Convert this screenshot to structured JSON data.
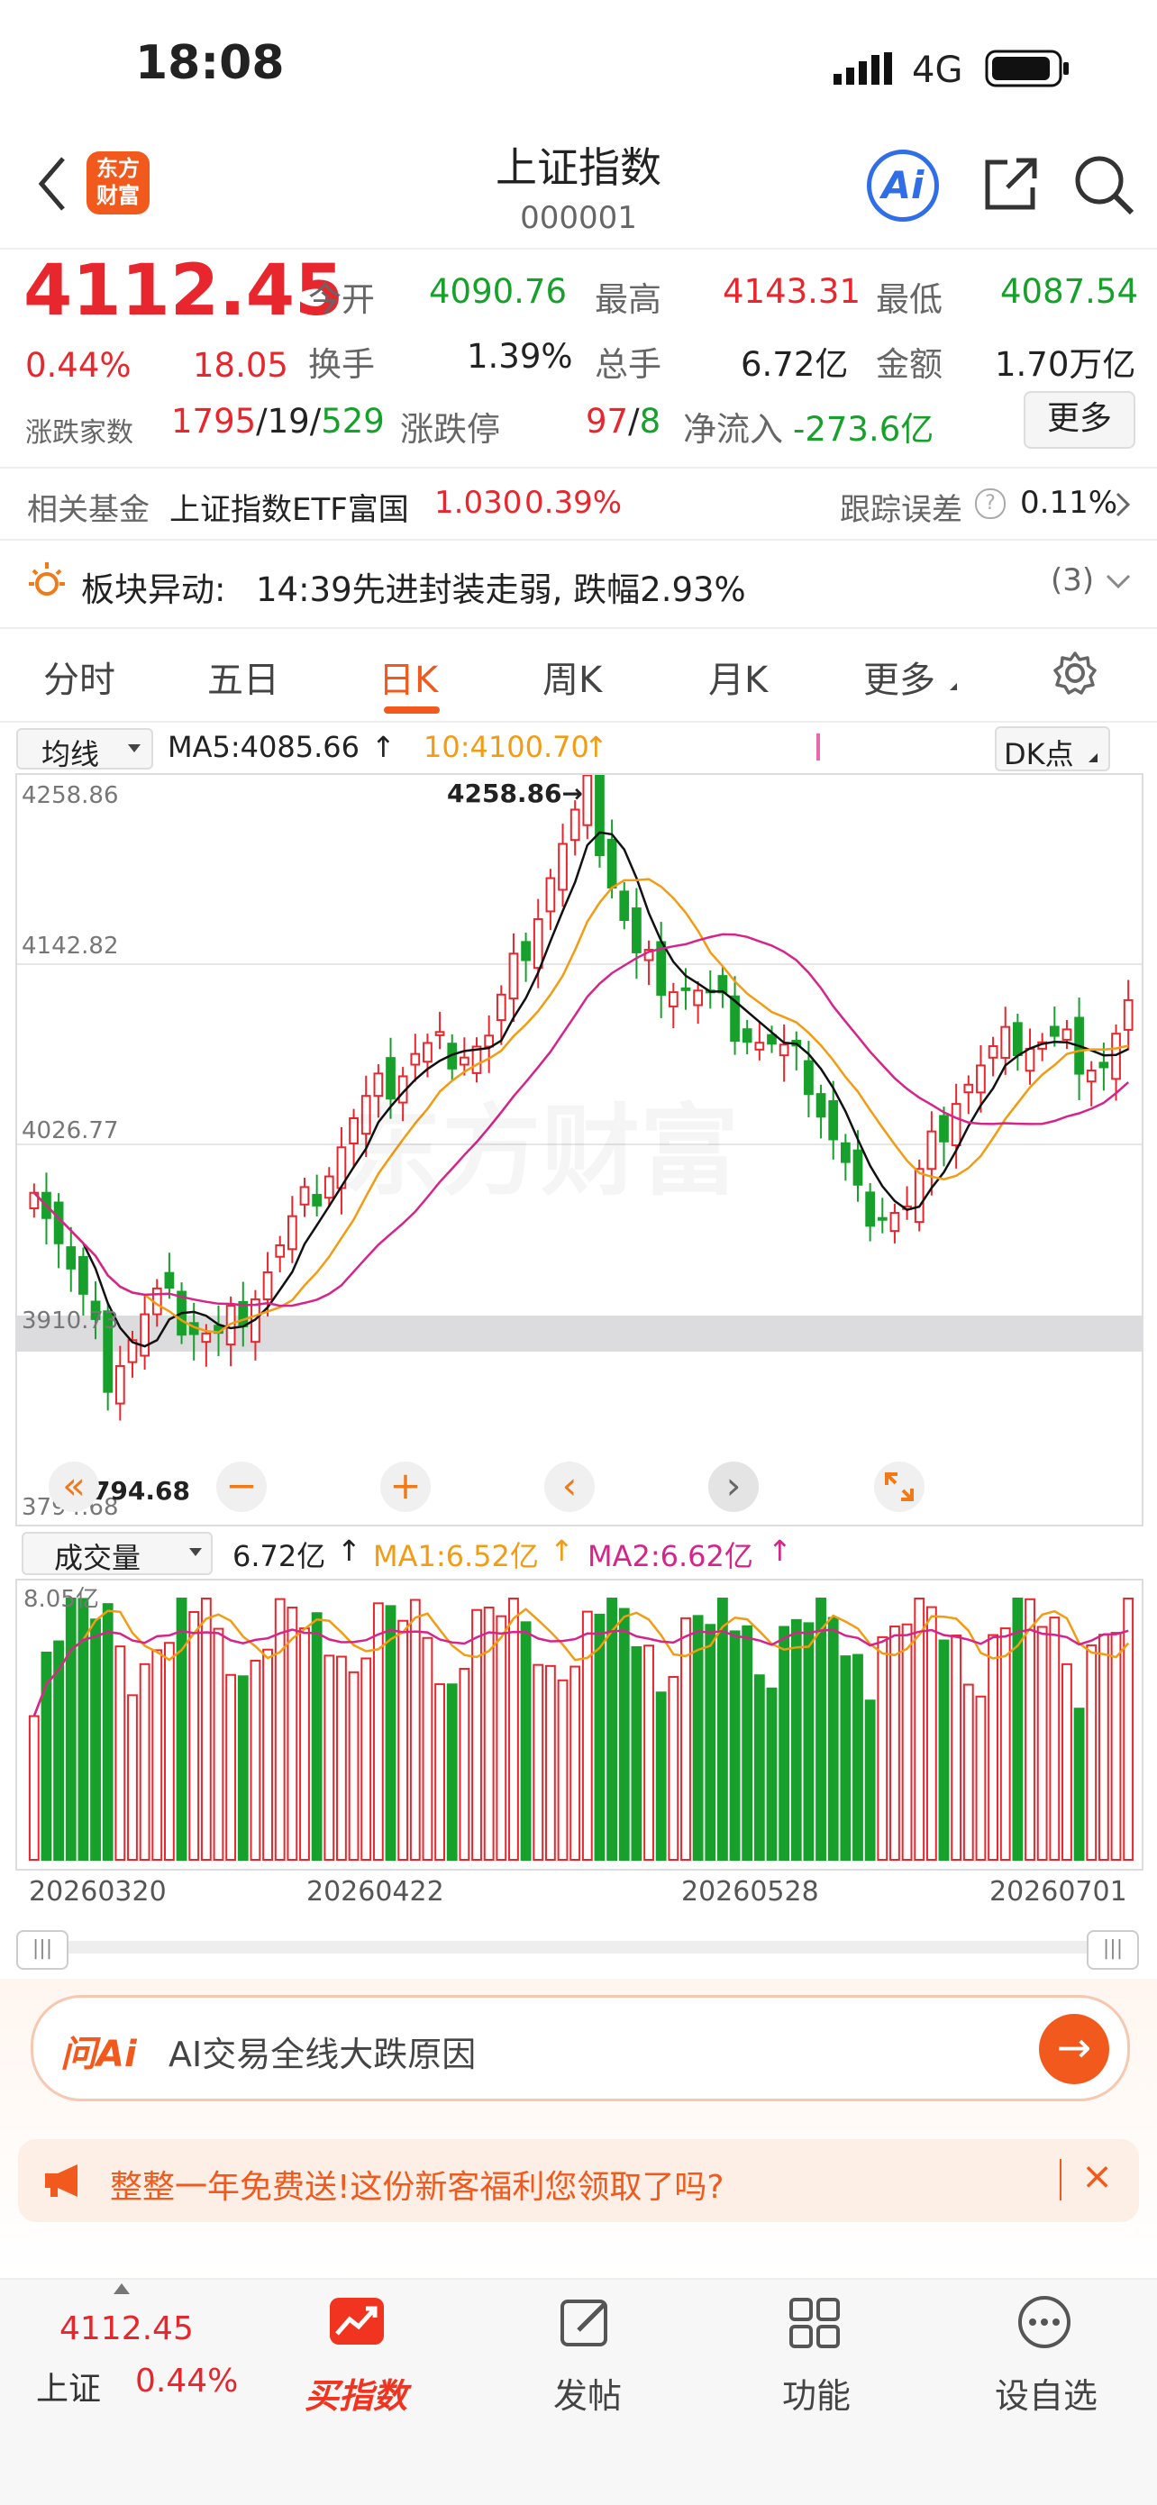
{
  "status_bar": {
    "time": "18:08",
    "network": "4G"
  },
  "header": {
    "title": "上证指数",
    "code": "000001",
    "logo_line1": "东方",
    "logo_line2": "财富",
    "ai_label": "Ai"
  },
  "quote": {
    "price": "4112.45",
    "change_pct": "0.44%",
    "change": "18.05",
    "open_label": "今开",
    "open": "4090.76",
    "high_label": "最高",
    "high": "4143.31",
    "low_label": "最低",
    "low": "4087.54",
    "turnover_label": "换手",
    "turnover": "1.39%",
    "volume_label": "总手",
    "volume": "6.72亿",
    "amount_label": "金额",
    "amount": "1.70万亿",
    "updown_label": "涨跌家数",
    "up": "1795",
    "sep1": "/",
    "flat": "19",
    "sep2": "/",
    "down": "529",
    "limit_label": "涨跌停",
    "limit_up": "97",
    "limit_sep": "/",
    "limit_down": "8",
    "netflow_label": "净流入",
    "netflow": "-273.6亿",
    "more_button": "更多"
  },
  "fund": {
    "label": "相关基金",
    "name": "上证指数ETF富国",
    "price": "1.030",
    "pct": "0.39%",
    "tracking_label": "跟踪误差",
    "help": "?",
    "tracking": "0.11%"
  },
  "alert": {
    "label": "板块异动:",
    "text": "14:39先进封装走弱, 跌幅2.93%",
    "count": "(3)"
  },
  "tabs": [
    "分时",
    "五日",
    "日K",
    "周K",
    "月K",
    "更多"
  ],
  "active_tab": 2,
  "indicator": {
    "ma_select": "均线",
    "ma5": "MA5:4085.66",
    "ma10": "10:4100.70",
    "dk": "DK点"
  },
  "chart_data": {
    "type": "candlestick",
    "y_ticks": [
      "4258.86",
      "4142.82",
      "4026.77",
      "3910.73",
      "3794.68"
    ],
    "ylim": [
      3794.68,
      4258.86
    ],
    "high_label": "4258.86",
    "low_label": "3794.68",
    "last_close": 4112.45,
    "x_ticks": [
      "20260320",
      "20260422",
      "20260528",
      "20260701"
    ],
    "colors": {
      "up": "#e8262d",
      "down": "#17a02b",
      "ma5": "#111111",
      "ma10": "#f39c12",
      "ma20": "#d6248a"
    }
  },
  "volume": {
    "select": "成交量",
    "value": "6.72亿",
    "ma1": "MA1:6.52亿",
    "ma2": "MA2:6.62亿",
    "top_tick": "8.05亿"
  },
  "ai_bar": {
    "brand": "问Ai",
    "text": "AI交易全线大跌原因"
  },
  "promo": {
    "text": "整整一年免费送!这份新客福利您领取了吗?",
    "close": "×"
  },
  "bottom_nav": {
    "index_price": "4112.45",
    "index_name": "上证",
    "index_pct": "0.44%",
    "buy_label": "买指数",
    "post_label": "发帖",
    "func_label": "功能",
    "watch_label": "设自选"
  }
}
